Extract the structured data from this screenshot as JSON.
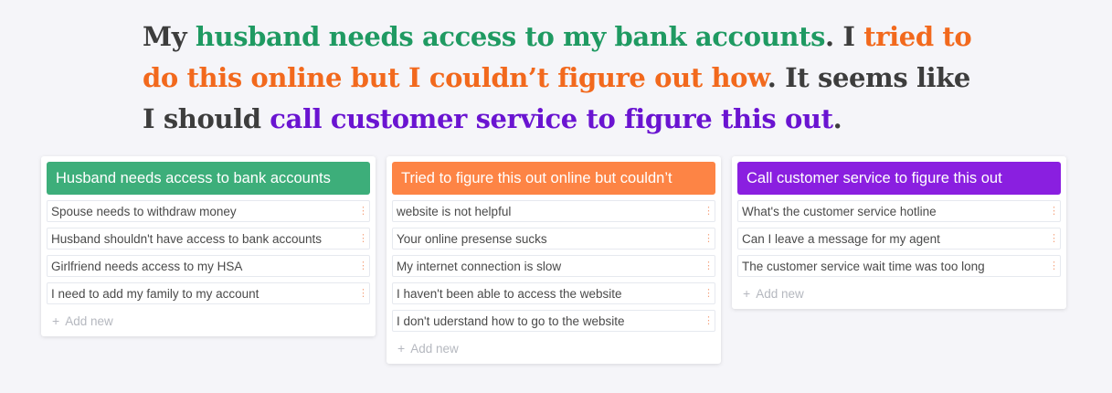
{
  "headline": {
    "p1": "My ",
    "s1": "husband needs access to my bank accounts",
    "p2": ". I ",
    "s2": "tried to do this online but I couldn’t figure out how",
    "p3": ". It seems like I should ",
    "s3": "call customer service to figure this out",
    "p4": "."
  },
  "colors": {
    "green": "#3dae7a",
    "orange": "#fd8445",
    "purple": "#8a1fe0"
  },
  "columns": [
    {
      "title": "Husband needs access to bank accounts",
      "items": [
        "Spouse needs to withdraw money",
        "Husband shouldn't have access to bank accounts",
        "Girlfriend needs access to my HSA",
        "I need to add my family to my account"
      ],
      "add_label": "Add new"
    },
    {
      "title": "Tried to figure this out online but couldn’t",
      "items": [
        "website is not helpful",
        "Your online presense sucks",
        "My internet connection is slow",
        "I haven't been able to access the website",
        "I don't uderstand how to go to the website"
      ],
      "add_label": "Add new"
    },
    {
      "title": "Call customer service to figure this out",
      "items": [
        "What's the customer service hotline",
        "Can I leave a message for my agent",
        "The customer service wait time was too long"
      ],
      "add_label": "Add new"
    }
  ],
  "icons": {
    "item_menu": "kebab-icon",
    "add": "plus-icon"
  }
}
